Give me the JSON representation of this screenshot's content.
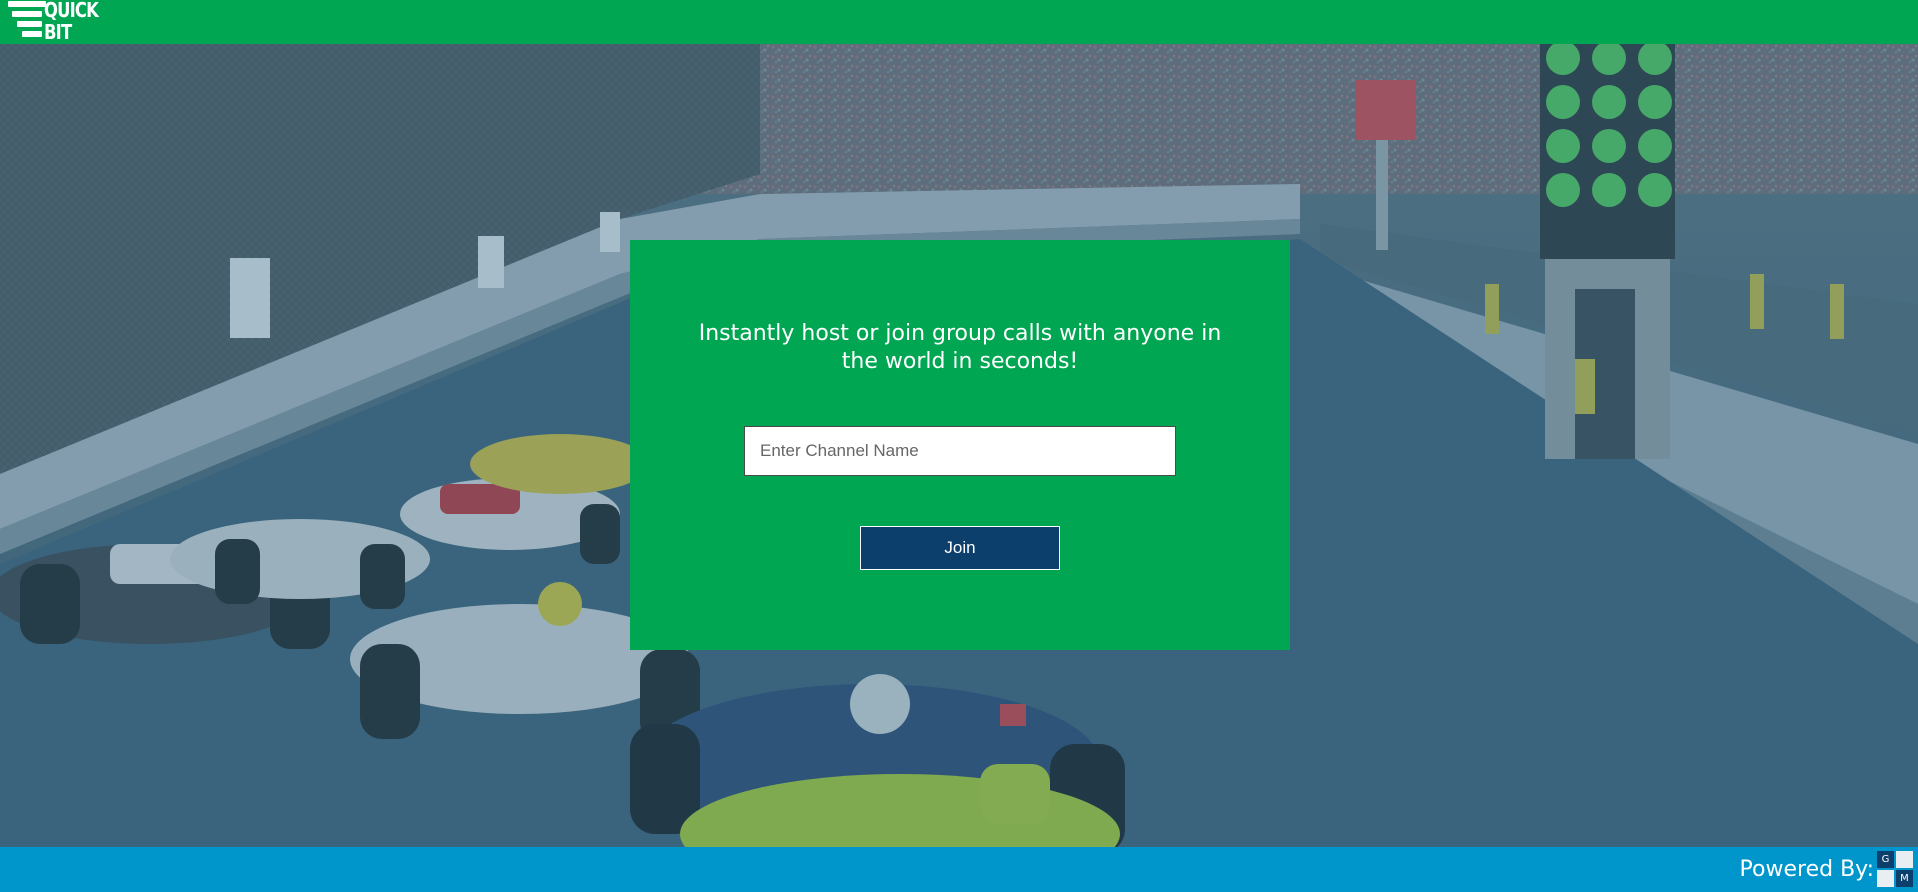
{
  "header": {
    "logo_line1": "QUICK",
    "logo_line2": "BIT"
  },
  "main": {
    "tagline": "Instantly host or join group calls with anyone in the world in seconds!",
    "channel_input": {
      "value": "",
      "placeholder": "Enter Channel Name"
    },
    "join_label": "Join"
  },
  "footer": {
    "powered_by": "Powered By:",
    "gm_logo_letters": [
      "G",
      "M"
    ]
  },
  "colors": {
    "brand_green": "#00a651",
    "footer_blue": "#0096cc",
    "button_navy": "#0c3f6b",
    "scene_overlay": "#2d6a8c"
  },
  "icons": {
    "logo": "quickbit-stacked-bars-logo",
    "footer_logo": "gm-checker-logo"
  }
}
